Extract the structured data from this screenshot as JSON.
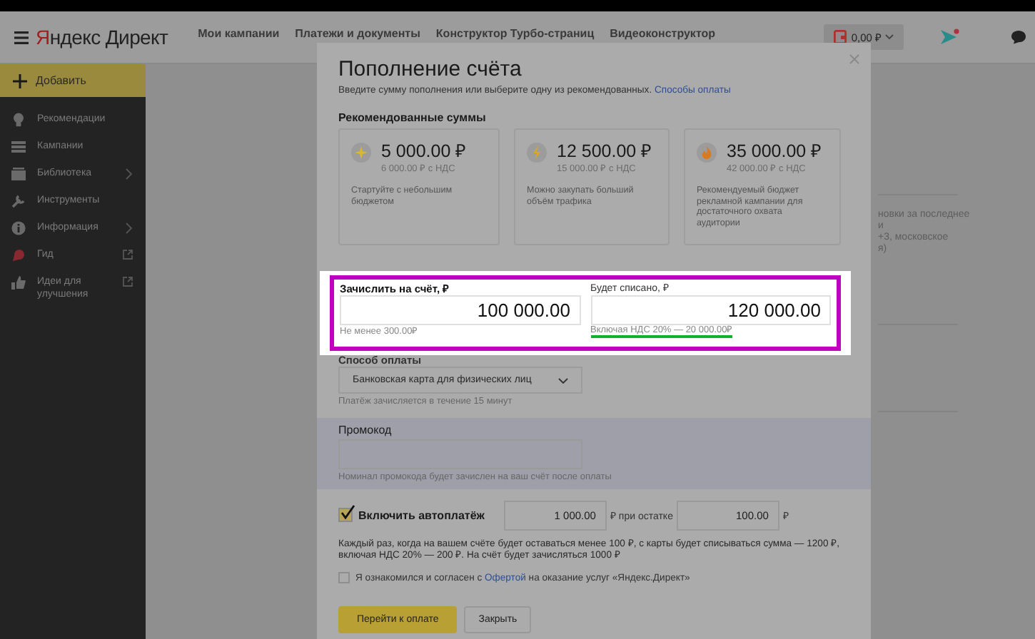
{
  "header": {
    "logo": {
      "initial": "Я",
      "rest": "ндекс",
      "product": "Директ"
    },
    "nav": [
      "Мои кампании",
      "Платежи и документы",
      "Конструктор Турбо-страниц",
      "Видеоконструктор"
    ],
    "balance": "0,00 ₽"
  },
  "sidebar": {
    "add_button": "Добавить",
    "items": [
      {
        "label": "Рекомендации",
        "submenu": false,
        "external": false
      },
      {
        "label": "Кампании",
        "submenu": false,
        "external": false
      },
      {
        "label": "Библиотека",
        "submenu": true,
        "external": false
      },
      {
        "label": "Инструменты",
        "submenu": false,
        "external": false
      },
      {
        "label": "Информация",
        "submenu": true,
        "external": false
      },
      {
        "label": "Гид",
        "submenu": false,
        "external": true
      },
      {
        "label": "Идеи для улучшения",
        "submenu": false,
        "external": true
      }
    ]
  },
  "page_behind": {
    "lines": [
      "новки за последнее",
      "и",
      "+3, московское",
      "я)"
    ]
  },
  "dialog": {
    "title": "Пополнение счёта",
    "subtitle": "Введите сумму пополнения или выберите одну из рекомендованных.",
    "subtitle_link": "Способы оплаты",
    "recommended_title": "Рекомендованные суммы",
    "recommended": [
      {
        "amount": "5 000.00 ₽",
        "with_vat": "6 000.00 ₽ с НДС",
        "description": "Стартуйте с небольшим бюджетом",
        "color": "#d8b830"
      },
      {
        "amount": "12 500.00 ₽",
        "with_vat": "15 000.00 ₽ с НДС",
        "description": "Можно закупать больший объём трафика",
        "color": "#d8a820"
      },
      {
        "amount": "35 000.00 ₽",
        "with_vat": "42 000.00 ₽ с НДС",
        "description": "Рекомендуемый бюджет рекламной кампании для достаточного охвата аудитории",
        "color": "#d87a20"
      }
    ],
    "amount_section": {
      "highlighted": true,
      "credit_label": "Зачислить на счёт, ₽",
      "credit_value": "100 000.00",
      "credit_hint": "Не менее 300.00₽",
      "charge_label": "Будет списано, ₽",
      "charge_value": "120 000.00",
      "charge_hint": "Включая НДС 20% — 20 000.00₽",
      "charge_hint_underlined": true
    },
    "payment_label": "Способ оплаты",
    "payment_method": "Банковская карта для физических лиц",
    "payment_hint": "Платёж зачисляется в течение 15 минут",
    "promo": {
      "label": "Промокод",
      "hint": "Номинал промокода будет зачислен на ваш счёт после оплаты"
    },
    "autopay": {
      "checked": true,
      "label": "Включить автоплатёж",
      "amount": "1 000.00",
      "threshold_label": "₽ при остатке",
      "threshold": "100.00",
      "currency": "₽",
      "note": "Каждый раз, когда на вашем счёте будет оставаться менее 100 ₽, с карты будет списываться сумма — 1200 ₽, включая НДС 20% — 200 ₽. На счёт будет зачисляться 1000 ₽"
    },
    "agreement": {
      "checked": false,
      "before": "Я ознакомился и согласен с",
      "link": "Офертой",
      "after": "на оказание услуг «Яндекс.Директ»"
    },
    "buttons": [
      "Перейти к оплате",
      "Закрыть"
    ]
  }
}
